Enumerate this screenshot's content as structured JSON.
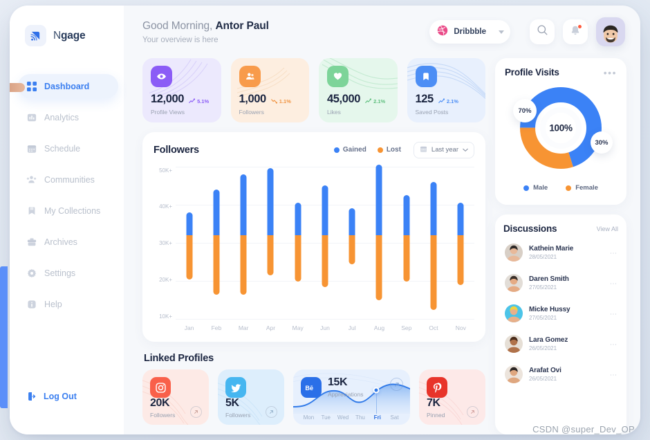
{
  "brand": {
    "name_light": "N",
    "name_bold": "gage",
    "logo_icon": "broadcast-icon"
  },
  "sidebar": {
    "items": [
      {
        "label": "Dashboard",
        "icon": "grid-icon",
        "active": true
      },
      {
        "label": "Analytics",
        "icon": "bar-chart-icon",
        "active": false
      },
      {
        "label": "Schedule",
        "icon": "calendar-icon",
        "active": false
      },
      {
        "label": "Communities",
        "icon": "people-icon",
        "active": false
      },
      {
        "label": "My Collections",
        "icon": "bookmark-icon",
        "active": false
      },
      {
        "label": "Archives",
        "icon": "briefcase-icon",
        "active": false
      },
      {
        "label": "Settings",
        "icon": "gear-icon",
        "active": false
      },
      {
        "label": "Help",
        "icon": "info-icon",
        "active": false
      }
    ],
    "logout_label": "Log Out",
    "logout_icon": "logout-icon"
  },
  "header": {
    "greeting_prefix": "Good Morning, ",
    "user_name": "Antor Paul",
    "subtitle": "Your overview is here",
    "account_pill": {
      "label": "Dribbble",
      "icon": "dribbble-icon"
    },
    "search_icon": "search-icon",
    "notification_icon": "bell-icon",
    "avatar": "user-avatar"
  },
  "stats": [
    {
      "value": "12,000",
      "label": "Profile Views",
      "trend": "5.1%",
      "direction": "up",
      "icon": "eye-icon",
      "accent": "#8b5cf6",
      "trend_color": "#8b5cf6"
    },
    {
      "value": "1,000",
      "label": "Followers",
      "trend": "1.1%",
      "direction": "down",
      "icon": "users-icon",
      "accent": "#f89b4b",
      "trend_color": "#f89b4b"
    },
    {
      "value": "45,000",
      "label": "Likes",
      "trend": "2.1%",
      "direction": "up",
      "icon": "heart-icon",
      "accent": "#7dd499",
      "trend_color": "#5fbf7e"
    },
    {
      "value": "125",
      "label": "Saved Posts",
      "trend": "2.1%",
      "direction": "up",
      "icon": "bookmark-icon",
      "accent": "#4c8ef5",
      "trend_color": "#4c8ef5"
    }
  ],
  "chart_card": {
    "title": "Followers",
    "legend": [
      {
        "label": "Gained",
        "color": "#3b82f6"
      },
      {
        "label": "Lost",
        "color": "#f79433"
      }
    ],
    "range_label": "Last year",
    "range_icon": "calendar-icon"
  },
  "chart_data": {
    "type": "bar",
    "title": "Followers",
    "xlabel": "",
    "ylabel": "",
    "ylim": [
      10000,
      50000
    ],
    "ytick_labels": [
      "50K+",
      "40K+",
      "30K+",
      "20K+",
      "10K+"
    ],
    "ytick_values": [
      50000,
      40000,
      30000,
      20000,
      10000
    ],
    "grid": true,
    "legend_position": "top-right",
    "categories": [
      "Jan",
      "Feb",
      "Mar",
      "Apr",
      "May",
      "Jun",
      "Jul",
      "Aug",
      "Sep",
      "Oct",
      "Nov"
    ],
    "stacked_split_value": 32000,
    "series": [
      {
        "name": "Gained",
        "color": "#3b82f6",
        "values": [
          38000,
          44000,
          48000,
          49500,
          40500,
          45000,
          39000,
          50500,
          42500,
          46000,
          40500
        ]
      },
      {
        "name": "Lost",
        "color": "#f79433",
        "values": [
          20500,
          16500,
          16500,
          21500,
          20000,
          18500,
          24500,
          15000,
          20000,
          12500,
          19000
        ]
      }
    ]
  },
  "linked_profiles": {
    "title": "Linked Profiles",
    "cards": [
      {
        "type": "simple",
        "platform": "instagram",
        "icon": "instagram-icon",
        "value": "20K",
        "label": "Followers",
        "icon_bg": "#f9604a",
        "card_bg": "#fdeae6",
        "arrow_icon": "arrow-up-right-icon"
      },
      {
        "type": "simple",
        "platform": "twitter",
        "icon": "twitter-icon",
        "value": "5K",
        "label": "Followers",
        "icon_bg": "#46b6f0",
        "card_bg": "#ddeefc",
        "arrow_icon": "arrow-up-right-icon"
      },
      {
        "type": "chart",
        "platform": "behance",
        "icon": "behance-icon",
        "value": "15K",
        "label": "Appreciations",
        "icon_bg": "#2a6fe8",
        "card_bg": "#e7f0fd",
        "arrow_icon": "arrow-up-right-icon",
        "days": [
          "Mon",
          "Tue",
          "Wed",
          "Thu",
          "Fri",
          "Sat"
        ],
        "active_day": "Fri"
      },
      {
        "type": "simple",
        "platform": "pinterest",
        "icon": "pinterest-icon",
        "value": "7K",
        "label": "Pinned",
        "icon_bg": "#e8342a",
        "card_bg": "#fde9e8",
        "arrow_icon": "arrow-up-right-icon"
      }
    ]
  },
  "profile_visits": {
    "title": "Profile Visits",
    "menu_icon": "more-horizontal-icon",
    "center_value": "100%",
    "segments": [
      {
        "label": "Male",
        "percent": "70%",
        "value": 70,
        "color": "#3b82f6"
      },
      {
        "label": "Female",
        "percent": "30%",
        "value": 30,
        "color": "#f79433"
      }
    ]
  },
  "discussions": {
    "title": "Discussions",
    "view_all_label": "View All",
    "menu_icon": "kebab-menu-icon",
    "items": [
      {
        "name": "Kathein Marie",
        "date": "28/05/2021",
        "avatar_bg": "#d8cfc6",
        "skin": "#e8b99a",
        "hair": "#2f2a28"
      },
      {
        "name": "Daren Smith",
        "date": "27/05/2021",
        "avatar_bg": "#e2ddd7",
        "skin": "#e5ab84",
        "hair": "#3a2f28"
      },
      {
        "name": "Micke Hussy",
        "date": "27/05/2021",
        "avatar_bg": "#4cc4e8",
        "skin": "#e8b08a",
        "hair": "#f2d33f"
      },
      {
        "name": "Lara Gomez",
        "date": "26/05/2021",
        "avatar_bg": "#e6dfd6",
        "skin": "#b0724a",
        "hair": "#4a2c1b"
      },
      {
        "name": "Arafat Ovi",
        "date": "26/05/2021",
        "avatar_bg": "#ece4dc",
        "skin": "#dfa77f",
        "hair": "#2b2523"
      }
    ]
  },
  "watermark": "CSDN @super_Dev_OP"
}
